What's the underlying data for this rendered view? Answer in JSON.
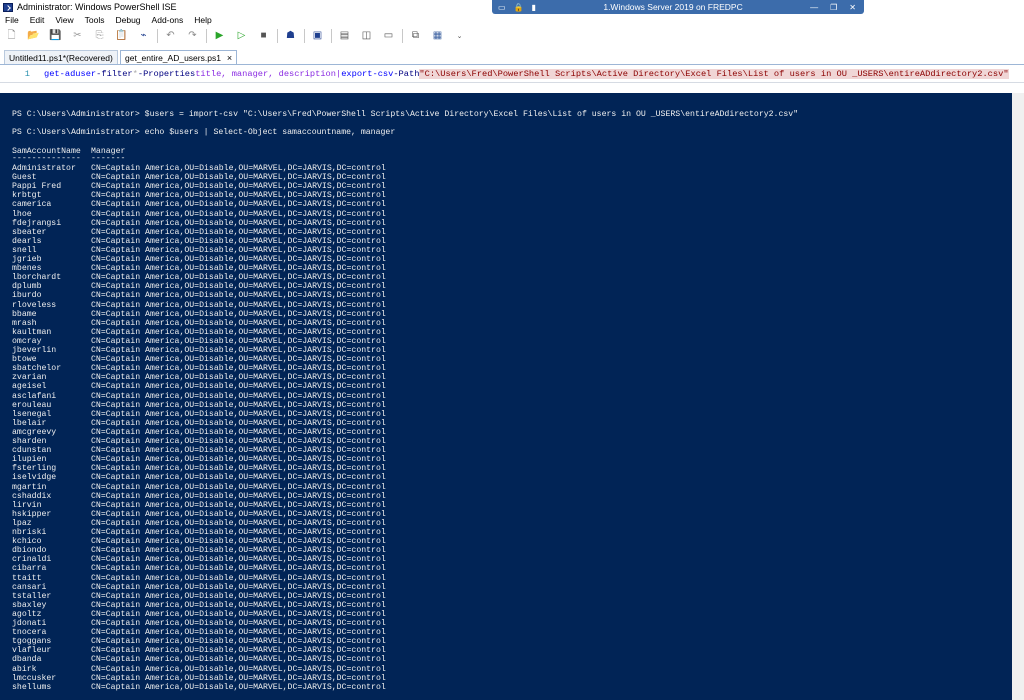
{
  "window": {
    "title": "Administrator: Windows PowerShell ISE",
    "remote_title": "1.Windows Server 2019 on FREDPC"
  },
  "menu": [
    "File",
    "Edit",
    "View",
    "Tools",
    "Debug",
    "Add-ons",
    "Help"
  ],
  "tabs": [
    {
      "label": "Untitled11.ps1*(Recovered)",
      "active": false
    },
    {
      "label": "get_entire_AD_users.ps1",
      "active": true,
      "close": "×"
    }
  ],
  "editor": {
    "line_number": "1",
    "cmd": "get-aduser",
    "param1": "-filter",
    "op": "*",
    "param2": "-Properties",
    "args": "title, manager, description|",
    "cmd2": "export-csv",
    "param3": "-Path",
    "path": "\"C:\\Users\\Fred\\PowerShell Scripts\\Active Directory\\Excel Files\\List of users in OU _USERS\\entireADdirectory2.csv\""
  },
  "console": {
    "prompt1": "PS C:\\Users\\Administrator> $users = import-csv \"C:\\Users\\Fred\\PowerShell Scripts\\Active Directory\\Excel Files\\List of users in OU _USERS\\entireADdirectory2.csv\"",
    "prompt2": "PS C:\\Users\\Administrator> echo $users | Select-Object samaccountname, manager",
    "header_sam": "SamAccountName",
    "header_mgr": "Manager",
    "underline_sam": "--------------",
    "underline_mgr": "-------",
    "manager_value": "CN=Captain America,OU=Disable,OU=MARVEL,DC=JARVIS,DC=control",
    "rows": [
      "Administrator",
      "Guest",
      "Pappi Fred",
      "krbtgt",
      "camerica",
      "lhoe",
      "fdejrangsi",
      "sbeater",
      "dearls",
      "snell",
      "jgrieb",
      "mbenes",
      "lborchardt",
      "dplumb",
      "iburdo",
      "rloveless",
      "bbame",
      "mrash",
      "kaultman",
      "omcray",
      "jbeverlin",
      "btowe",
      "sbatchelor",
      "zvarian",
      "ageisel",
      "asclafani",
      "erouleau",
      "lsenegal",
      "lbelair",
      "amcgreevy",
      "sharden",
      "cdunstan",
      "ilupien",
      "fsterling",
      "iselvidge",
      "mgartin",
      "cshaddix",
      "lirvin",
      "hskipper",
      "lpaz",
      "nbriski",
      "kchico",
      "dbiondo",
      "crinaldi",
      "cibarra",
      "ttaitt",
      "cansari",
      "tstaller",
      "sbaxley",
      "agoltz",
      "jdonati",
      "tnocera",
      "tgoggans",
      "vlafleur",
      "dbanda",
      "abirk",
      "lmccusker",
      "shellums"
    ]
  }
}
